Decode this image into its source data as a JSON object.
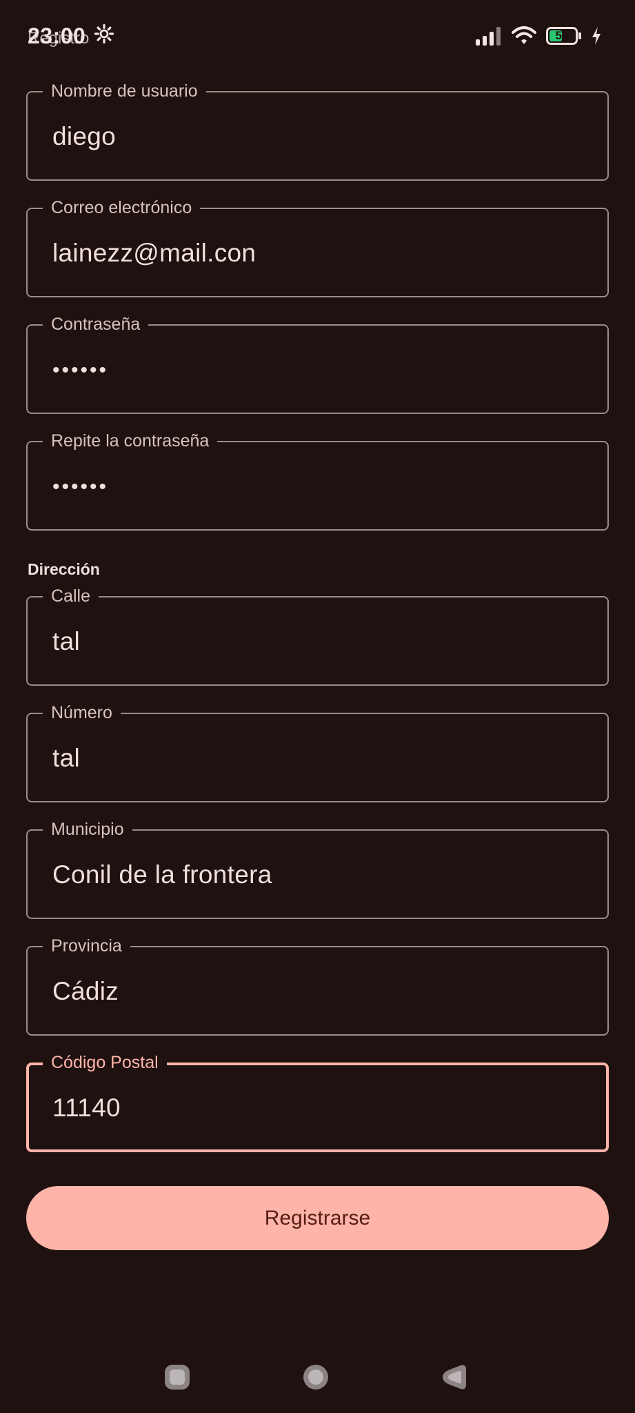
{
  "status_bar": {
    "time": "23:00",
    "overlap_title": "Registro",
    "battery_level": "51",
    "battery_fraction": 0.51,
    "icons": [
      "settings-gear-icon",
      "signal-icon",
      "wifi-icon",
      "battery-icon",
      "charging-bolt-icon"
    ]
  },
  "form": {
    "fields": [
      {
        "label": "Nombre de usuario",
        "value": "diego"
      },
      {
        "label": "Correo electrónico",
        "value": "lainezz@mail.con"
      },
      {
        "label": "Contraseña",
        "value": "••••••"
      },
      {
        "label": "Repite la contraseña",
        "value": "••••••"
      }
    ],
    "address_section_label": "Dirección",
    "address_fields": [
      {
        "label": "Calle",
        "value": "tal"
      },
      {
        "label": "Número",
        "value": "tal"
      },
      {
        "label": "Municipio",
        "value": "Conil de la frontera"
      },
      {
        "label": "Provincia",
        "value": "Cádiz"
      },
      {
        "label": "Código Postal",
        "value": "11140"
      }
    ],
    "submit_label": "Registrarse"
  },
  "colors": {
    "background": "#1e1110",
    "accent": "#ffb4a9",
    "outline": "#9d8c89",
    "button_text": "#561e17"
  },
  "nav_bar": {
    "icons": [
      "recents-icon",
      "home-icon",
      "back-icon"
    ]
  }
}
